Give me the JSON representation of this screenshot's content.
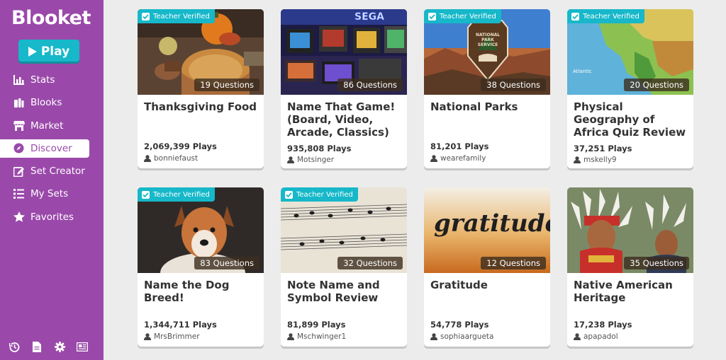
{
  "app": {
    "logo": "Blooket",
    "play_label": "Play"
  },
  "colors": {
    "sidebar": "#9a49aa",
    "accent": "#16b8c9",
    "background": "#ececec"
  },
  "nav": [
    {
      "label": "Stats",
      "icon": "bar-chart-icon"
    },
    {
      "label": "Blooks",
      "icon": "blooks-icon"
    },
    {
      "label": "Market",
      "icon": "store-icon"
    },
    {
      "label": "Discover",
      "icon": "compass-icon",
      "active": true
    },
    {
      "label": "Set Creator",
      "icon": "edit-icon"
    },
    {
      "label": "My Sets",
      "icon": "list-icon"
    },
    {
      "label": "Favorites",
      "icon": "star-icon"
    }
  ],
  "bottom_icons": [
    "history-icon",
    "document-icon",
    "gear-icon",
    "news-icon"
  ],
  "verified_label": "Teacher Verified",
  "cards": [
    {
      "title": "Thanksgiving Food",
      "questions": "19 Questions",
      "plays": "2,069,399 Plays",
      "author": "bonniefaust",
      "verified": true,
      "image": "thanksgiving-food-image"
    },
    {
      "title": "Name That Game! (Board, Video, Arcade, Classics)",
      "questions": "86 Questions",
      "plays": "935,808 Plays",
      "author": "Motsinger",
      "verified": false,
      "image": "retro-game-consoles-image",
      "image_text": "SEGA"
    },
    {
      "title": "National Parks",
      "questions": "38 Questions",
      "plays": "81,201 Plays",
      "author": "wearefamily",
      "verified": true,
      "image": "national-park-sign-image",
      "image_text": "NATIONAL PARK SERVICE"
    },
    {
      "title": "Physical Geography of Africa Quiz Review",
      "questions": "20 Questions",
      "plays": "37,251 Plays",
      "author": "mskelly9",
      "verified": true,
      "image": "africa-map-image",
      "image_text": "Atlantic"
    },
    {
      "title": "Name the Dog Breed!",
      "questions": "83 Questions",
      "plays": "1,344,711 Plays",
      "author": "MrsBrimmer",
      "verified": true,
      "image": "puppy-image"
    },
    {
      "title": "Note Name and Symbol Review",
      "questions": "32 Questions",
      "plays": "81,899 Plays",
      "author": "Mschwinger1",
      "verified": true,
      "image": "sheet-music-image"
    },
    {
      "title": "Gratitude",
      "questions": "12 Questions",
      "plays": "54,778 Plays",
      "author": "sophiaargueta",
      "verified": false,
      "image": "gratitude-lettering-image",
      "image_text": "gratitude:"
    },
    {
      "title": "Native American Heritage",
      "questions": "35 Questions",
      "plays": "17,238 Plays",
      "author": "apapadol",
      "verified": false,
      "image": "native-american-regalia-image"
    }
  ]
}
